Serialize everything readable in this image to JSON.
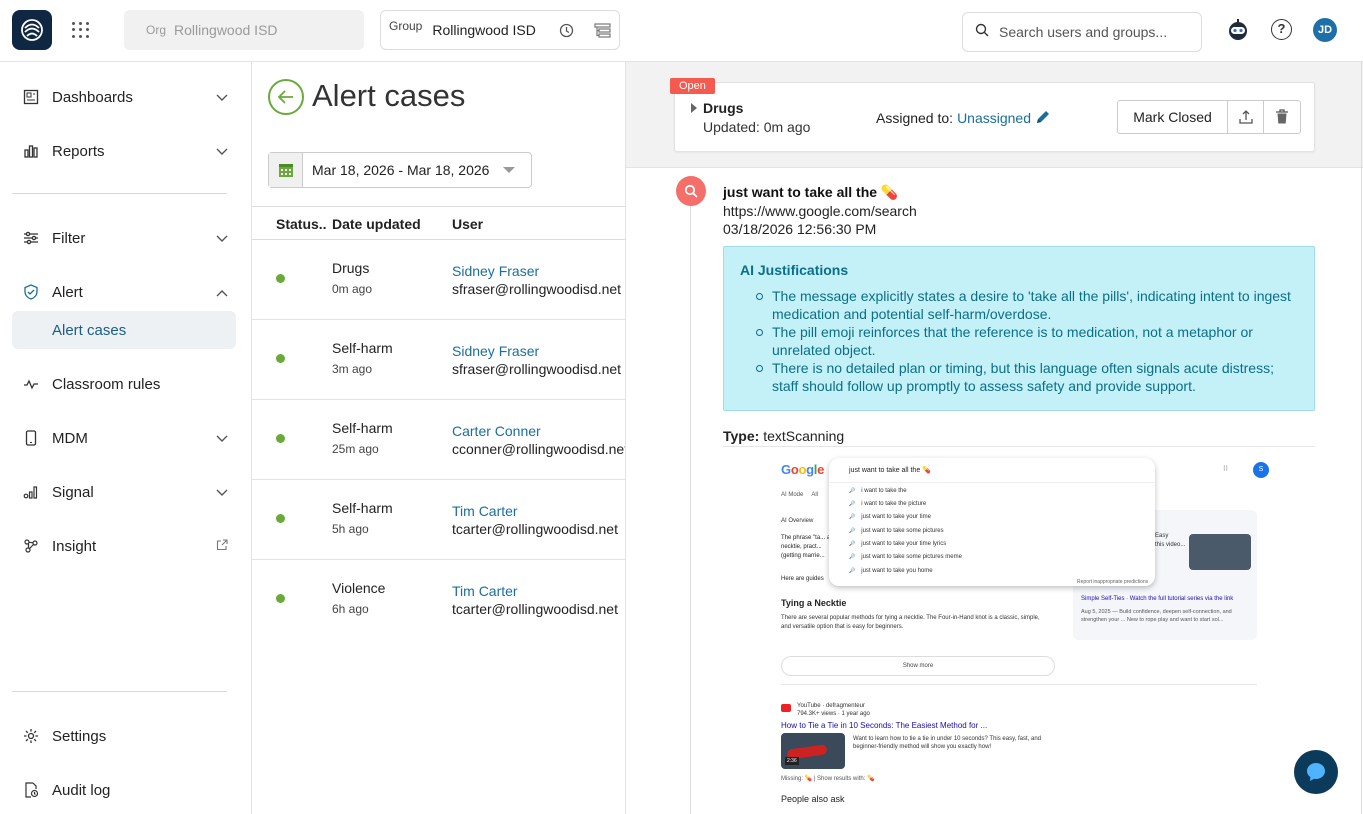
{
  "topbar": {
    "org_label": "Org",
    "org_value": "Rollingwood ISD",
    "group_label": "Group",
    "group_value": "Rollingwood ISD",
    "search_placeholder": "Search users and groups...",
    "help_glyph": "?",
    "avatar_initials": "JD"
  },
  "sidebar": {
    "items": [
      {
        "label": "Dashboards",
        "icon": "dashboard-icon"
      },
      {
        "label": "Reports",
        "icon": "bar-chart-icon"
      },
      {
        "label": "Filter",
        "icon": "sliders-icon"
      },
      {
        "label": "Alert",
        "icon": "shield-check-icon"
      },
      {
        "label": "Alert cases"
      },
      {
        "label": "Classroom rules",
        "icon": "pulse-icon"
      },
      {
        "label": "MDM",
        "icon": "phone-icon"
      },
      {
        "label": "Signal",
        "icon": "signal-icon"
      },
      {
        "label": "Insight",
        "icon": "network-icon"
      }
    ],
    "footer": [
      {
        "label": "Settings",
        "icon": "gear-icon"
      },
      {
        "label": "Audit log",
        "icon": "audit-log-icon"
      }
    ]
  },
  "list": {
    "title": "Alert cases",
    "date_range": "Mar 18, 2026 - Mar 18, 2026",
    "columns": [
      "Status..",
      "Date updated",
      "User"
    ],
    "rows": [
      {
        "type": "Drugs",
        "ago": "0m ago",
        "name": "Sidney Fraser",
        "email": "sfraser@rollingwoodisd.net"
      },
      {
        "type": "Self-harm",
        "ago": "3m ago",
        "name": "Sidney Fraser",
        "email": "sfraser@rollingwoodisd.net"
      },
      {
        "type": "Self-harm",
        "ago": "25m ago",
        "name": "Carter Conner",
        "email": "cconner@rollingwoodisd.net"
      },
      {
        "type": "Self-harm",
        "ago": "5h ago",
        "name": "Tim Carter",
        "email": "tcarter@rollingwoodisd.net"
      },
      {
        "type": "Violence",
        "ago": "6h ago",
        "name": "Tim Carter",
        "email": "tcarter@rollingwoodisd.net"
      }
    ],
    "status_color": "#6aaa3a"
  },
  "detail": {
    "badge": "Open",
    "case_title": "Drugs",
    "updated": "Updated: 0m ago",
    "assigned_label": "Assigned to:",
    "assigned_value": "Unassigned",
    "mark_closed": "Mark Closed",
    "event": {
      "title": "just want to take all the 💊",
      "url": "https://www.google.com/search",
      "time": "03/18/2026 12:56:30 PM"
    },
    "ai": {
      "title": "AI Justifications",
      "points": [
        "The message explicitly states a desire to 'take all the pills', indicating intent to ingest medication and potential self-harm/overdose.",
        "The pill emoji reinforces that the reference is to medication, not a metaphor or unrelated object.",
        "There is no detailed plan or timing, but this language often signals acute distress; staff should follow up promptly to assess safety and provide support."
      ]
    },
    "type_label": "Type:",
    "type_value": "textScanning"
  },
  "screenshot": {
    "logo": "Google",
    "query": "just want to take all the 💊",
    "suggestions": [
      "i want to take the",
      "i want to take the picture",
      "just want to take your time",
      "just want to take some pictures",
      "just want to take your time lyrics",
      "just want to take some pictures meme",
      "just want to take you home"
    ],
    "tabs": [
      "AI Mode",
      "All"
    ],
    "overview": "AI Overview",
    "overview_text": "The phrase \"ta... a necktie, pract... (getting marrie...",
    "guides": "Here are guides",
    "heading": "Tying a Necktie",
    "para": "There are several popular methods for tying a necktie. The Four-in-Hand knot is a classic, simple, and versatile option that is easy for beginners.",
    "show_more": "Show more",
    "yt_source": "YouTube · defragmenteur",
    "yt_meta": "794.3K+ views · 1 year ago",
    "yt_title": "How to Tie a Tie in 10 Seconds: The Easiest Method for ...",
    "yt_desc": "Want to learn how to tie a tie in under 10 seconds? This easy, fast, and beginner-friendly method will show you exactly how!",
    "yt_duration": "2:36",
    "missing": "Missing: 💊 | Show results with: 💊",
    "paa": "People also ask",
    "right_easy": "Easy",
    "right_video": "this video...",
    "right_series": "Simple Self-Ties · Watch the full tutorial series via the link",
    "right_desc": "Aug 5, 2025 — Build confidence, deepen self-connection, and strengthen your ... New to rope play and want to start sol...",
    "report": "Report inappropriate predictions",
    "user_initial": "S"
  }
}
